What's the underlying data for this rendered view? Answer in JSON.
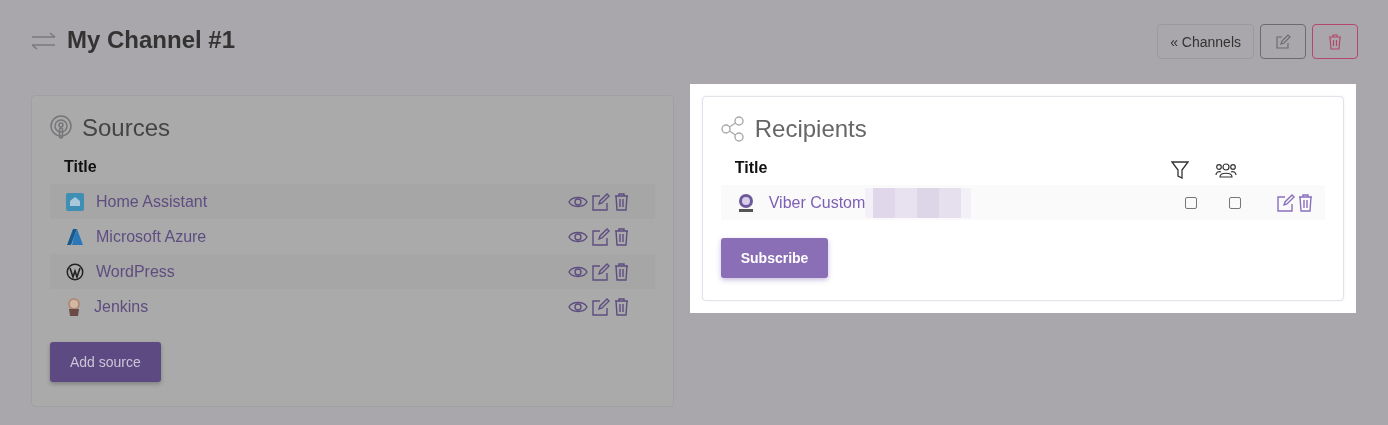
{
  "page": {
    "title": "My Channel #1"
  },
  "toolbar": {
    "back_button": "« Channels"
  },
  "sources": {
    "heading": "Sources",
    "column": "Title",
    "rows": [
      {
        "kind": "home",
        "title": "Home Assistant"
      },
      {
        "kind": "azure",
        "title": "Microsoft Azure"
      },
      {
        "kind": "wordpress",
        "title": "WordPress"
      },
      {
        "kind": "jenkins",
        "title": "Jenkins"
      }
    ],
    "button": "Add source"
  },
  "recipients": {
    "heading": "Recipients",
    "column": "Title",
    "rows": [
      {
        "title": "Viber Custom",
        "redacted": true,
        "filter": {
          "checked": false
        },
        "group": {
          "checked": false
        }
      }
    ],
    "button": "Subscribe"
  }
}
